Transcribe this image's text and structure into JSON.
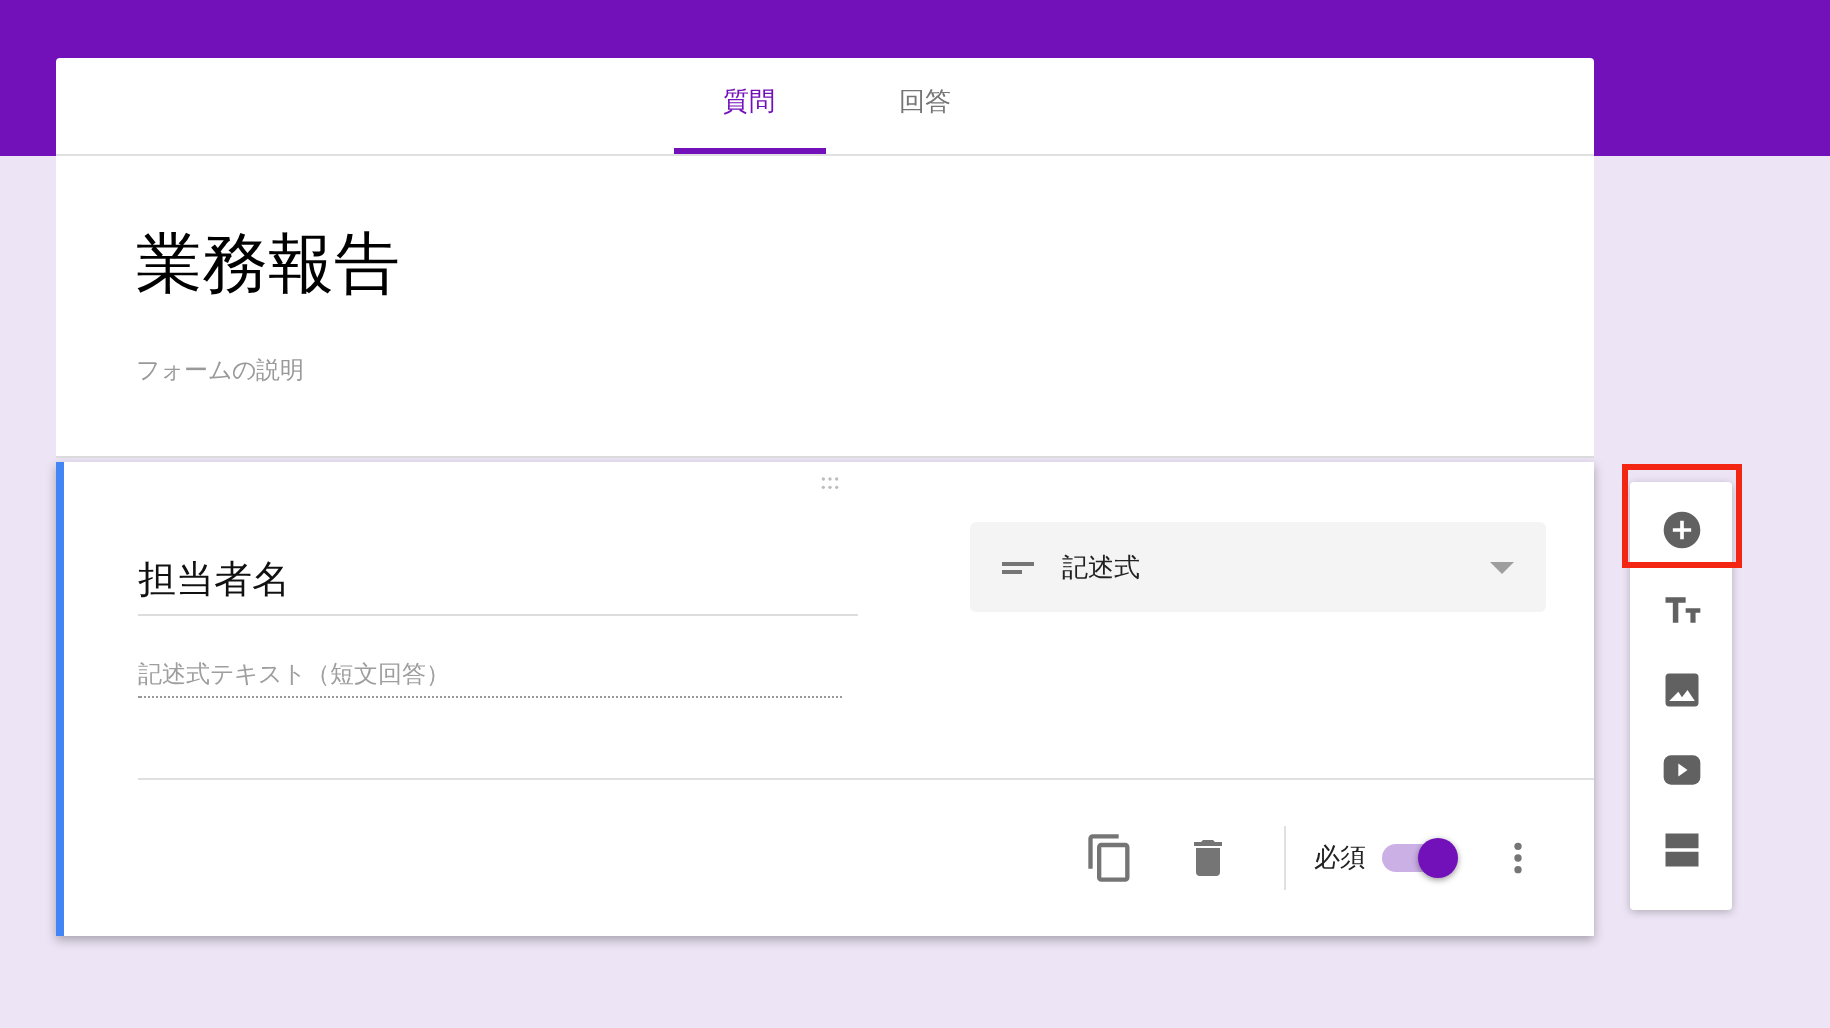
{
  "tabs": [
    {
      "label": "質問",
      "selected": true
    },
    {
      "label": "回答",
      "selected": false
    }
  ],
  "form": {
    "title": "業務報告",
    "description": {
      "placeholder": "フォームの説明"
    }
  },
  "question": {
    "active": true,
    "title": "担当者名",
    "answer": {
      "placeholder": "記述式テキスト（短文回答）"
    },
    "type": {
      "label": "記述式"
    },
    "required": {
      "label": "必須",
      "on": true
    }
  },
  "toolbar": [
    {
      "kind": "add",
      "highlighted": true
    },
    {
      "kind": "title",
      "highlighted": false
    },
    {
      "kind": "image",
      "highlighted": false
    },
    {
      "kind": "video",
      "highlighted": false
    },
    {
      "kind": "section",
      "highlighted": false
    }
  ]
}
